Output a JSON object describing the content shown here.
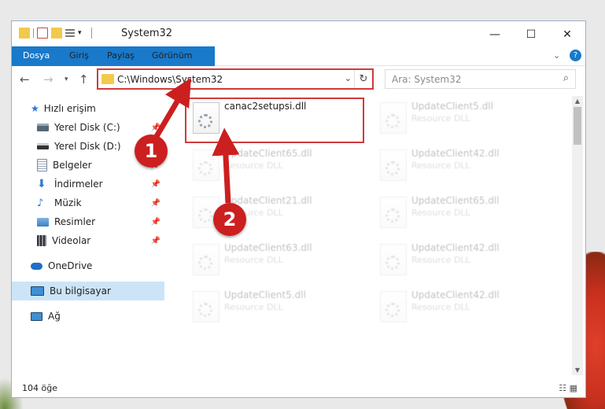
{
  "window": {
    "title": "System32"
  },
  "ribbon": {
    "tabs": [
      "Dosya",
      "Giriş",
      "Paylaş",
      "Görünüm"
    ]
  },
  "address": {
    "path": "C:\\Windows\\System32"
  },
  "search": {
    "placeholder": "Ara: System32"
  },
  "sidebar": {
    "items": [
      {
        "label": "Hızlı erişim",
        "icon": "star-icon",
        "pinned": false
      },
      {
        "label": "Yerel Disk (C:)",
        "icon": "disk-icon",
        "pinned": true
      },
      {
        "label": "Yerel Disk (D:)",
        "icon": "disk-icon",
        "pinned": true
      },
      {
        "label": "Belgeler",
        "icon": "documents-icon",
        "pinned": true
      },
      {
        "label": "İndirmeler",
        "icon": "download-icon",
        "pinned": true
      },
      {
        "label": "Müzik",
        "icon": "music-icon",
        "pinned": true
      },
      {
        "label": "Resimler",
        "icon": "pictures-icon",
        "pinned": true
      },
      {
        "label": "Videolar",
        "icon": "videos-icon",
        "pinned": true
      },
      {
        "label": "OneDrive",
        "icon": "cloud-icon",
        "pinned": false
      },
      {
        "label": "Bu bilgisayar",
        "icon": "computer-icon",
        "pinned": false
      },
      {
        "label": "Ağ",
        "icon": "network-icon",
        "pinned": false
      }
    ]
  },
  "files": [
    {
      "name": "canac2setupsi.dll",
      "type": ""
    },
    {
      "name": "UpdateClient5.dll",
      "type": "Resource DLL"
    },
    {
      "name": "UpdateClient65.dll",
      "type": "Resource DLL"
    },
    {
      "name": "UpdateClient42.dll",
      "type": "Resource DLL"
    },
    {
      "name": "UpdateClient21.dll",
      "type": "Resource DLL"
    },
    {
      "name": "UpdateClient65.dll",
      "type": "Resource DLL"
    },
    {
      "name": "UpdateClient63.dll",
      "type": "Resource DLL"
    },
    {
      "name": "UpdateClient42.dll",
      "type": "Resource DLL"
    },
    {
      "name": "UpdateClient5.dll",
      "type": "Resource DLL"
    },
    {
      "name": "UpdateClient42.dll",
      "type": "Resource DLL"
    }
  ],
  "status": {
    "count": "104 öğe"
  },
  "callouts": [
    "1",
    "2"
  ],
  "colors": {
    "accent": "#1979ca",
    "highlight": "#d23a3a",
    "callout": "#cc1f1f"
  }
}
